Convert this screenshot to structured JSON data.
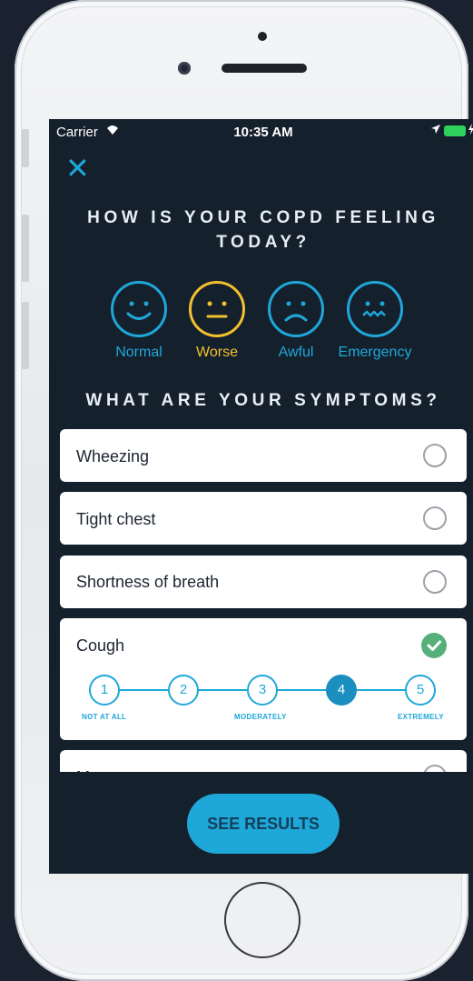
{
  "status_bar": {
    "carrier": "Carrier",
    "time": "10:35 AM"
  },
  "header": {
    "close_glyph": "✕",
    "question": "HOW IS YOUR COPD FEELING TODAY?"
  },
  "feelings": [
    {
      "label": "Normal",
      "icon": "happy-face-icon",
      "color": "#1ea7d9",
      "selected": false
    },
    {
      "label": "Worse",
      "icon": "neutral-face-icon",
      "color": "#f2c12e",
      "selected": true
    },
    {
      "label": "Awful",
      "icon": "sad-face-icon",
      "color": "#1ea7d9",
      "selected": false
    },
    {
      "label": "Emergency",
      "icon": "distressed-face-icon",
      "color": "#1ea7d9",
      "selected": false
    }
  ],
  "symptoms_heading": "WHAT ARE YOUR SYMPTOMS?",
  "symptoms": [
    {
      "label": "Wheezing",
      "checked": false
    },
    {
      "label": "Tight chest",
      "checked": false
    },
    {
      "label": "Shortness of breath",
      "checked": false
    },
    {
      "label": "Cough",
      "checked": true,
      "severity": 4
    },
    {
      "label": "M",
      "checked": false
    }
  ],
  "severity_scale": {
    "steps": [
      "1",
      "2",
      "3",
      "4",
      "5"
    ],
    "low_label": "NOT AT ALL",
    "mid_label": "MODERATELY",
    "high_label": "EXTREMELY"
  },
  "see_results_label": "SEE RESULTS",
  "colors": {
    "accent": "#1ea7d9",
    "selected_face": "#f2c12e",
    "check": "#55b07a",
    "background": "#15202d"
  }
}
